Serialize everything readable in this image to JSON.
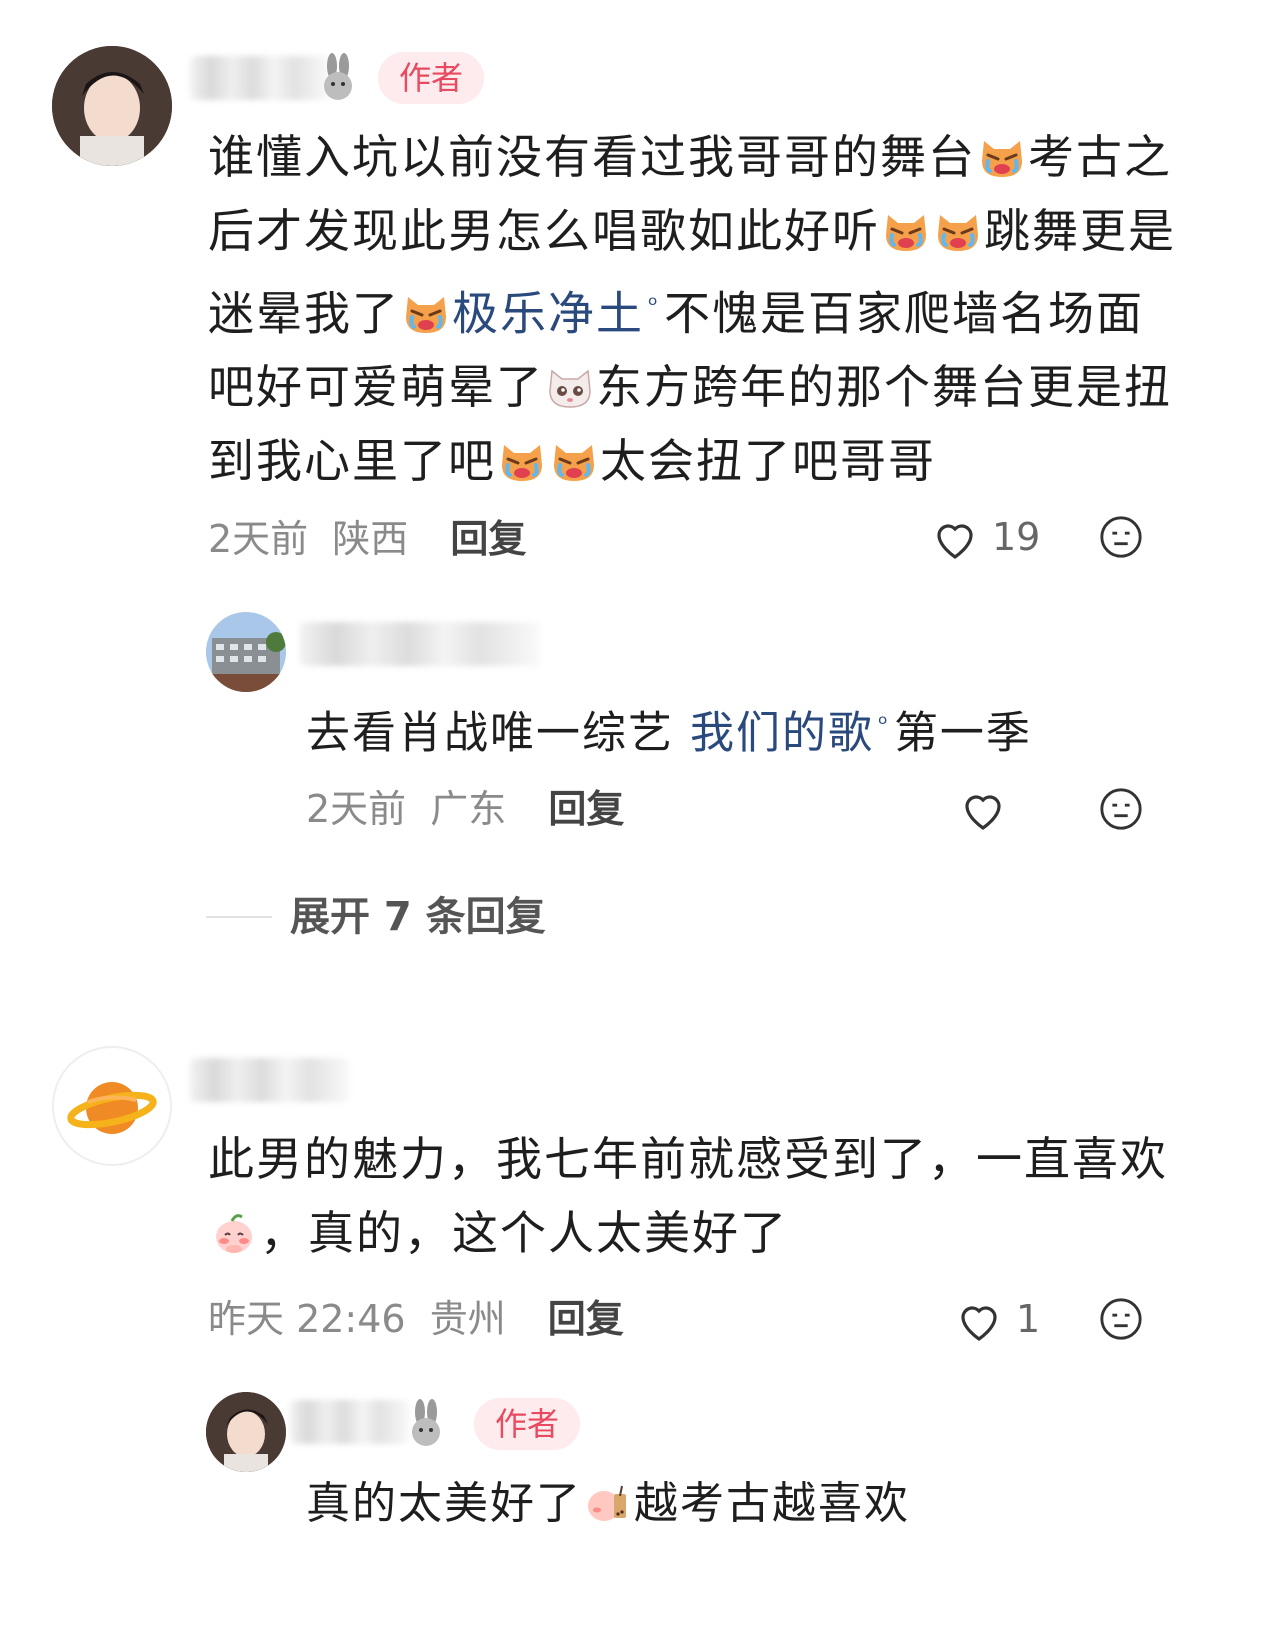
{
  "badges": {
    "author": "作者"
  },
  "comment1": {
    "segments": [
      {
        "t": "text",
        "v": "谁懂入坑以前没有看过我哥哥的舞台"
      },
      {
        "t": "emoji",
        "v": "crying-cat-emoji"
      },
      {
        "t": "text",
        "v": "考古之后才发现此男怎么唱歌如此好听"
      },
      {
        "t": "emoji",
        "v": "crying-cat-emoji"
      },
      {
        "t": "emoji",
        "v": "crying-cat-emoji"
      },
      {
        "t": "text",
        "v": "跳舞更是迷晕我了"
      },
      {
        "t": "emoji",
        "v": "crying-cat-emoji"
      },
      {
        "t": "link",
        "v": "极乐净土"
      },
      {
        "t": "text",
        "v": "不愧是百家爬墙名场面吧好可爱萌晕了"
      },
      {
        "t": "emoji",
        "v": "teary-cat-emoji"
      },
      {
        "t": "text",
        "v": "东方跨年的那个舞台更是扭到我心里了吧"
      },
      {
        "t": "emoji",
        "v": "crying-cat-emoji"
      },
      {
        "t": "emoji",
        "v": "crying-cat-emoji"
      },
      {
        "t": "text",
        "v": "太会扭了吧哥哥"
      }
    ],
    "time": "2天前",
    "location": "陕西",
    "reply_label": "回复",
    "likes": "19"
  },
  "reply1": {
    "segments": [
      {
        "t": "text",
        "v": "去看肖战唯一综艺 "
      },
      {
        "t": "link",
        "v": "我们的歌"
      },
      {
        "t": "text",
        "v": "第一季"
      }
    ],
    "time": "2天前",
    "location": "广东",
    "reply_label": "回复"
  },
  "expand": {
    "label": "展开 7 条回复"
  },
  "comment2": {
    "segments": [
      {
        "t": "text",
        "v": "此男的魅力，我七年前就感受到了，一直喜欢"
      },
      {
        "t": "emoji",
        "v": "blushing-peach-emoji"
      },
      {
        "t": "text",
        "v": "，真的，这个人太美好了"
      }
    ],
    "time": "昨天 22:46",
    "location": "贵州",
    "reply_label": "回复",
    "likes": "1"
  },
  "reply2": {
    "segments": [
      {
        "t": "text",
        "v": "真的太美好了"
      },
      {
        "t": "emoji",
        "v": "peach-milk-tea-emoji"
      },
      {
        "t": "text",
        "v": "越考古越喜欢"
      }
    ]
  },
  "colors": {
    "link": "#2a4a7d",
    "author_badge_bg": "#fdebed",
    "author_badge_text": "#e84a5f",
    "meta": "#8a8a8a"
  }
}
